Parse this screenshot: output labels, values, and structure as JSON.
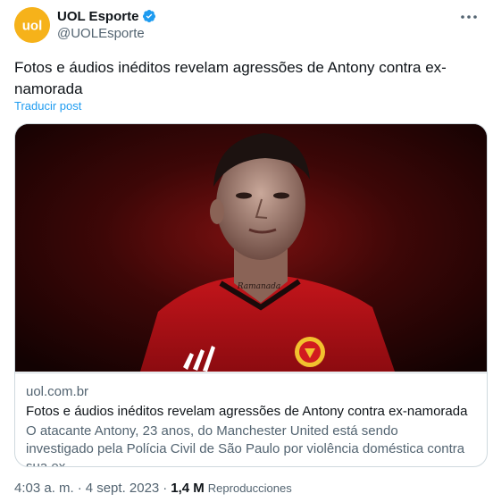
{
  "author": {
    "display_name": "UOL Esporte",
    "handle": "@UOLEsporte",
    "logo_text": "uol",
    "avatar_color": "#f6b21a",
    "verified_color": "#1d9bf0"
  },
  "tweet": {
    "text": "Fotos e áudios inéditos revelam agresões de Antony contra ex-namorada",
    "translate_label": "Traducir post"
  },
  "card": {
    "image_text": "Ramanada",
    "domain": "uol.com.br",
    "title": "Fotos e áudios inéditos revelam agressões de Antony contra ex-namorada",
    "description": "O atacante Antony, 23 anos, do Manchester United está sendo investigado pela Polícia Civil de São Paulo por violência doméstica contra sua ex-..."
  },
  "meta": {
    "time": "4:03 a. m.",
    "separator": "·",
    "date": "4 sept. 2023",
    "separator2": "·",
    "views": "1,4 M",
    "views_label": "Reproducciones"
  },
  "icons": {
    "more": "more-horizontal-icon",
    "verified": "verified-badge-icon"
  }
}
